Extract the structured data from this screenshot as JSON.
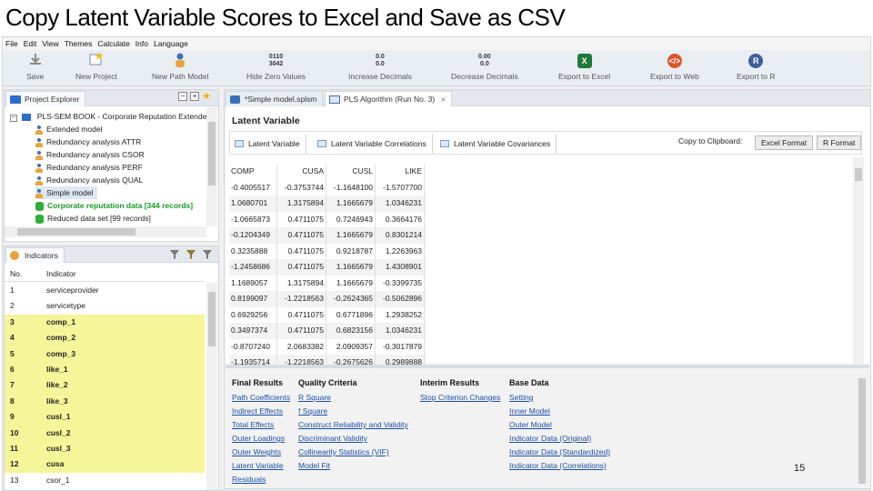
{
  "slide": {
    "title": "Copy Latent Variable Scores to Excel and Save as CSV",
    "page_number": "15"
  },
  "menu": [
    "File",
    "Edit",
    "View",
    "Themes",
    "Calculate",
    "Info",
    "Language"
  ],
  "toolbar": {
    "save": "Save",
    "new_project": "New Project",
    "new_path_model": "New Path Model",
    "hide_zero_values": "Hide Zero Values",
    "increase_decimals": "Increase Decimals",
    "decrease_decimals": "Decrease Decimals",
    "export_excel": "Export to Excel",
    "export_web": "Export to Web",
    "export_r": "Export to R",
    "hide_zero_icon_text": "0110\n3042",
    "inc_dec_icon_text": "0.0\n0.0",
    "dec_dec_icon_text": "0.00\n0.0"
  },
  "project_explorer": {
    "tab_label": "Project Explorer",
    "root": "PLS-SEM BOOK - Corporate Reputation Extended",
    "items": [
      {
        "label": "Extended model",
        "kind": "model"
      },
      {
        "label": "Redundancy analysis ATTR",
        "kind": "model"
      },
      {
        "label": "Redundancy analysis CSOR",
        "kind": "model"
      },
      {
        "label": "Redundancy analysis PERF",
        "kind": "model"
      },
      {
        "label": "Redundancy analysis QUAL",
        "kind": "model"
      },
      {
        "label": "Simple model",
        "kind": "model",
        "selected": true
      },
      {
        "label": "Corporate reputation data [344 records]",
        "kind": "data",
        "active": true
      },
      {
        "label": "Reduced data set [99 records]",
        "kind": "data"
      }
    ]
  },
  "indicators": {
    "tab_label": "Indicators",
    "col_no": "No.",
    "col_indicator": "Indicator",
    "rows": [
      {
        "no": "1",
        "name": "serviceprovider",
        "hl": false
      },
      {
        "no": "2",
        "name": "servicetype",
        "hl": false
      },
      {
        "no": "3",
        "name": "comp_1",
        "hl": true
      },
      {
        "no": "4",
        "name": "comp_2",
        "hl": true
      },
      {
        "no": "5",
        "name": "comp_3",
        "hl": true
      },
      {
        "no": "6",
        "name": "like_1",
        "hl": true
      },
      {
        "no": "7",
        "name": "like_2",
        "hl": true
      },
      {
        "no": "8",
        "name": "like_3",
        "hl": true
      },
      {
        "no": "9",
        "name": "cusl_1",
        "hl": true
      },
      {
        "no": "10",
        "name": "cusl_2",
        "hl": true
      },
      {
        "no": "11",
        "name": "cusl_3",
        "hl": true
      },
      {
        "no": "12",
        "name": "cusa",
        "hl": true
      },
      {
        "no": "13",
        "name": "csor_1",
        "hl": false
      }
    ]
  },
  "editor_tabs": {
    "model_tab": "*Simple model.splsm",
    "algo_tab": "PLS Algorithm (Run No. 3)"
  },
  "latent_variable": {
    "heading": "Latent Variable",
    "subtabs": [
      "Latent Variable",
      "Latent Variable Correlations",
      "Latent Variable Covariances"
    ],
    "copy_label": "Copy to Clipboard:",
    "excel_btn": "Excel Format",
    "r_btn": "R Format",
    "columns": [
      "COMP",
      "CUSA",
      "CUSL",
      "LIKE"
    ],
    "rows": [
      [
        "-0.4005517",
        "-0.3753744",
        "-1.1648100",
        "-1.5707700"
      ],
      [
        "1.0680701",
        "1.3175894",
        "1.1665679",
        "1.0346231"
      ],
      [
        "-1.0665873",
        "0.4711075",
        "0.7246943",
        "0.3664176"
      ],
      [
        "-0.1204349",
        "0.4711075",
        "1.1665679",
        "0.8301214"
      ],
      [
        "0.3235888",
        "0.4711075",
        "0.9218787",
        "1.2263963"
      ],
      [
        "-1.2458686",
        "0.4711075",
        "1.1665679",
        "1.4308901"
      ],
      [
        "1.1689057",
        "1.3175894",
        "1.1665679",
        "-0.3399735"
      ],
      [
        "0.8199097",
        "-1.2218563",
        "-0.2624365",
        "-0.5062896"
      ],
      [
        "0.6929256",
        "0.4711075",
        "0.6771896",
        "1.2938252"
      ],
      [
        "0.3497374",
        "0.4711075",
        "0.6823156",
        "1.0346231"
      ],
      [
        "-0.8707240",
        "2.0683382",
        "2.0909357",
        "-0.3017879"
      ],
      [
        "-1.1935714",
        "-1.2218563",
        "-0.2675626",
        "0.2989888"
      ]
    ]
  },
  "results": {
    "columns": [
      {
        "title": "Final Results",
        "links": [
          "Path Coefficients",
          "Indirect Effects",
          "Total Effects",
          "Outer Loadings",
          "Outer Weights",
          "Latent Variable",
          "Residuals"
        ]
      },
      {
        "title": "Quality Criteria",
        "links": [
          "R Square",
          "f Square",
          "Construct Reliability and Validity",
          "Discriminant Validity",
          "Collinearity Statistics (VIF)",
          "Model Fit"
        ]
      },
      {
        "title": "Interim Results",
        "links": [
          "Stop Criterion Changes"
        ]
      },
      {
        "title": "Base Data",
        "links": [
          "Setting",
          "Inner Model",
          "Outer Model",
          "Indicator Data (Original)",
          "Indicator Data (Standardized)",
          "Indicator Data (Correlations)"
        ]
      }
    ]
  }
}
